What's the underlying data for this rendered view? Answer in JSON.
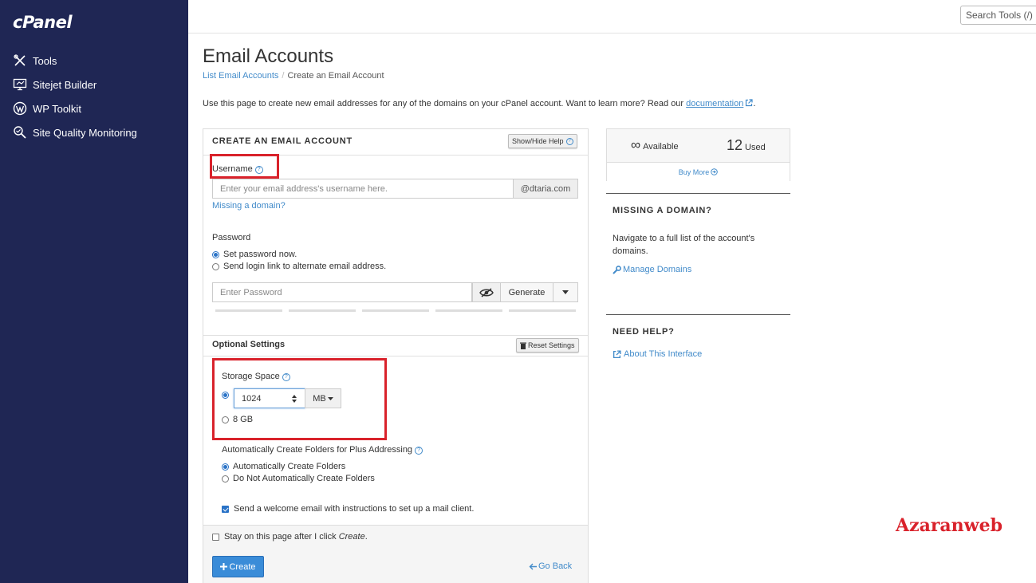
{
  "sidebar": {
    "logo": "cPanel",
    "items": [
      {
        "label": "Tools",
        "icon": "tools-icon"
      },
      {
        "label": "Sitejet Builder",
        "icon": "sitejet-icon"
      },
      {
        "label": "WP Toolkit",
        "icon": "wordpress-icon"
      },
      {
        "label": "Site Quality Monitoring",
        "icon": "site-quality-icon"
      }
    ]
  },
  "header": {
    "search_placeholder": "Search Tools (/)"
  },
  "page": {
    "title": "Email Accounts",
    "breadcrumb": {
      "parent": "List Email Accounts",
      "separator": "/",
      "current": "Create an Email Account"
    },
    "intro_text": "Use this page to create new email addresses for any of the domains on your cPanel account. Want to learn more? Read our",
    "intro_link": "documentation",
    "intro_end": "."
  },
  "form": {
    "heading": "CREATE AN EMAIL ACCOUNT",
    "show_hide_help": "Show/Hide Help",
    "username_label": "Username",
    "username_placeholder": "Enter your email address's username here.",
    "domain_suffix": "@dtaria.com",
    "missing_domain_link": "Missing a domain?",
    "password_label": "Password",
    "password_options": [
      {
        "label": "Set password now.",
        "checked": true
      },
      {
        "label": "Send login link to alternate email address.",
        "checked": false
      }
    ],
    "password_placeholder": "Enter Password",
    "generate_label": "Generate",
    "optional_heading": "Optional Settings",
    "reset_settings": "Reset Settings",
    "storage_label": "Storage Space",
    "storage_value": "1024",
    "storage_unit": "MB",
    "storage_alt_option": "8 GB",
    "plus_addressing_label": "Automatically Create Folders for Plus Addressing",
    "plus_options": [
      {
        "label": "Automatically Create Folders",
        "checked": true
      },
      {
        "label": "Do Not Automatically Create Folders",
        "checked": false
      }
    ],
    "welcome_email_label": "Send a welcome email with instructions to set up a mail client.",
    "stay_on_page_prefix": "Stay on this page after I click ",
    "stay_on_page_em": "Create",
    "stay_on_page_suffix": ".",
    "create_label": "Create",
    "go_back_label": "Go Back"
  },
  "side": {
    "available_symbol": "∞",
    "available_label": "Available",
    "used_count": "12",
    "used_label": "Used",
    "buy_more": "Buy More",
    "missing_domain_heading": "MISSING A DOMAIN?",
    "missing_domain_text_1": "Navigate to a full list of the account's",
    "missing_domain_text_2": "domains.",
    "manage_domains": "Manage Domains",
    "need_help_heading": "NEED HELP?",
    "about_interface": "About This Interface"
  },
  "watermark": "Azaranweb",
  "colors": {
    "sidebar_bg": "#1f2654",
    "link": "#428bca",
    "primary_button": "#3a8cd8",
    "highlight_box": "#d9222b"
  }
}
